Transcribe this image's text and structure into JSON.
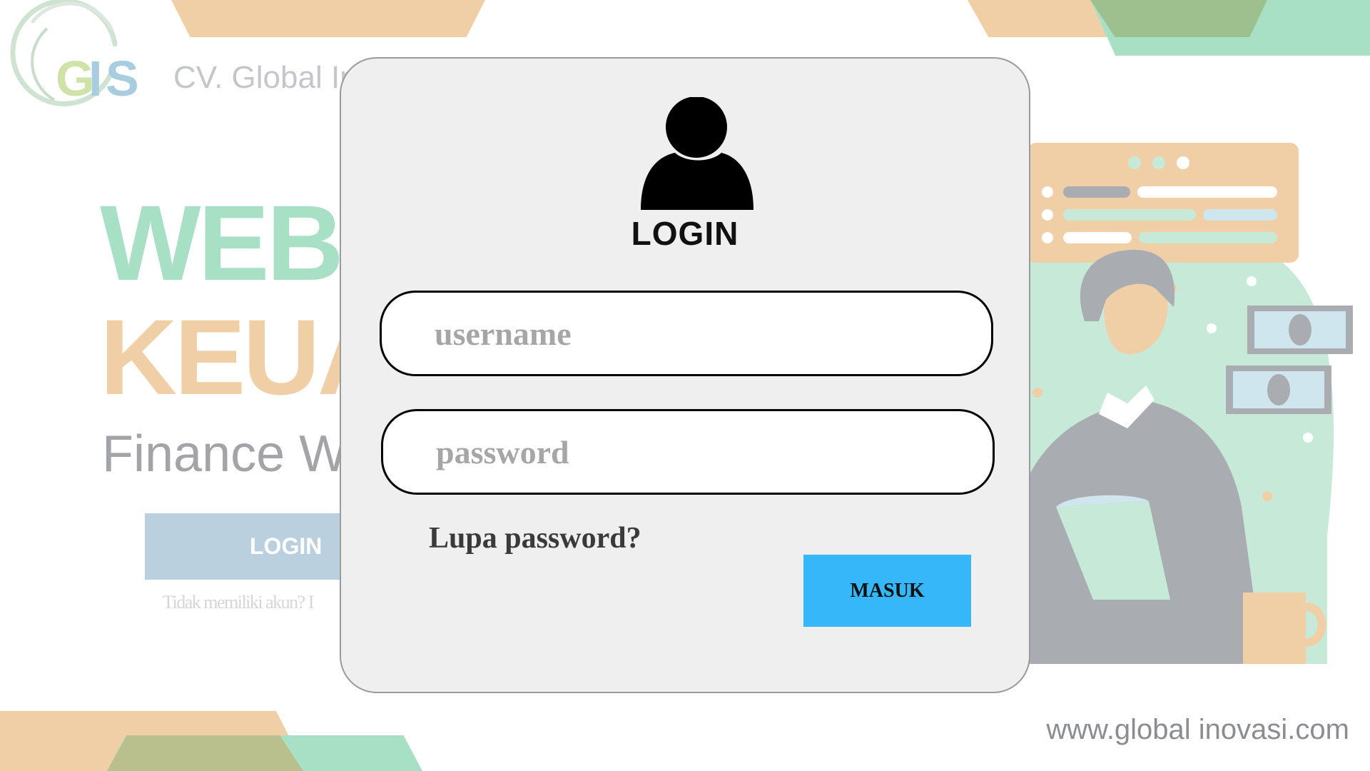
{
  "brand": {
    "logo_text": "GIS",
    "company_text": "CV. Global In"
  },
  "hero": {
    "line1": "WEBS",
    "line2": "KEUA",
    "subtitle": "Finance W"
  },
  "background_form": {
    "login_button_label": "LOGIN",
    "signup_prompt": "Tidak memiliki akun?  I"
  },
  "login_modal": {
    "title": "LOGIN",
    "username_placeholder": "username",
    "password_placeholder": "password",
    "forgot_link": "Lupa password?",
    "submit_label": "MASUK"
  },
  "footer": {
    "url": "www.global inovasi.com"
  },
  "colors": {
    "mint": "#a8e0c6",
    "peach": "#f0cfa6",
    "submit_blue": "#36b7fa",
    "modal_bg": "#f0eff0"
  }
}
